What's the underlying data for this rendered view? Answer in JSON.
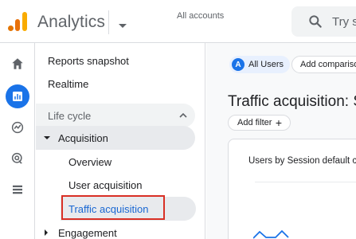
{
  "header": {
    "app_title": "Analytics",
    "account_selector": "All accounts",
    "search_placeholder": "Try s"
  },
  "rail": {
    "items": [
      {
        "icon": "home-icon",
        "active": false
      },
      {
        "icon": "reports-icon",
        "active": true
      },
      {
        "icon": "explore-icon",
        "active": false
      },
      {
        "icon": "advertising-icon",
        "active": false
      },
      {
        "icon": "configure-icon",
        "active": false
      }
    ]
  },
  "nav": {
    "reports_snapshot": "Reports snapshot",
    "realtime": "Realtime",
    "section_label": "Life cycle",
    "acquisition": "Acquisition",
    "overview": "Overview",
    "user_acquisition": "User acquisition",
    "traffic_acquisition": "Traffic acquisition",
    "engagement": "Engagement"
  },
  "main": {
    "segment_avatar": "A",
    "segment_label": "All Users",
    "comparison_label": "Add comparison",
    "page_title": "Traffic acquisition: S",
    "add_filter": "Add filter",
    "add_filter_plus": "+",
    "card_title": "Users by Session default c"
  },
  "colors": {
    "accent": "#1a73e8",
    "highlight": "#d93025",
    "nav_selected_text": "#1967d2"
  }
}
